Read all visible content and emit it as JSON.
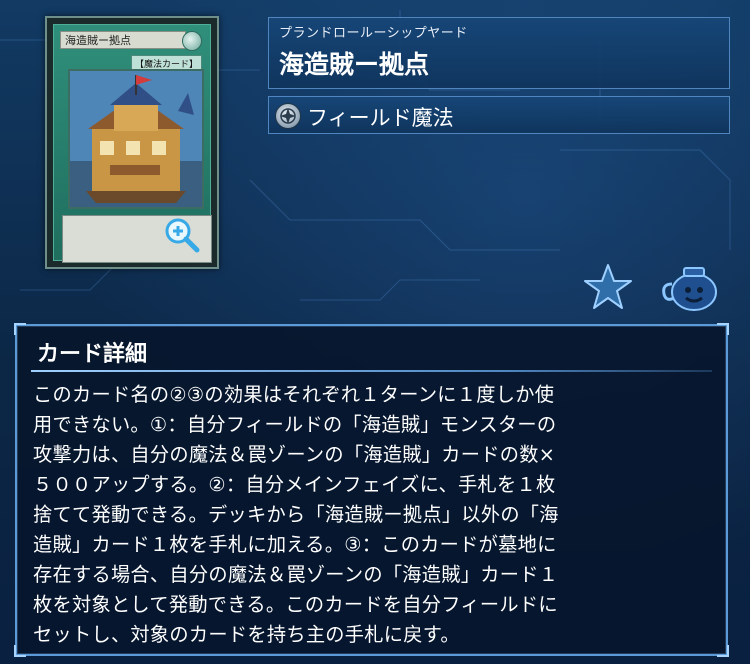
{
  "card": {
    "reading": "プランドロールーシップヤード",
    "name": "海造賊ー拠点",
    "frame_name": "海造賊ー拠点",
    "frame_type": "【魔法カード】",
    "type_label": "フィールド魔法",
    "type_icon": "field-spell-icon",
    "frame_color": "#2f8f7a"
  },
  "actions": {
    "zoom_icon": "zoom-in-icon",
    "favorite_icon": "star-icon",
    "misc_icon": "pot-icon"
  },
  "detail": {
    "title": "カード詳細",
    "text": "このカード名の②③の効果はそれぞれ１ターンに１度しか使\n用できない。①：自分フィールドの「海造賊」モンスターの\n攻撃力は、自分の魔法＆罠ゾーンの「海造賊」カードの数×\n５００アップする。②：自分メインフェイズに、手札を１枚\n捨てて発動できる。デッキから「海造賊ー拠点」以外の「海\n造賊」カード１枚を手札に加える。③：このカードが墓地に\n存在する場合、自分の魔法＆罠ゾーンの「海造賊」カード１\n枚を対象として発動できる。このカードを自分フィールドに\nセットし、対象のカードを持ち主の手札に戻す。"
  }
}
